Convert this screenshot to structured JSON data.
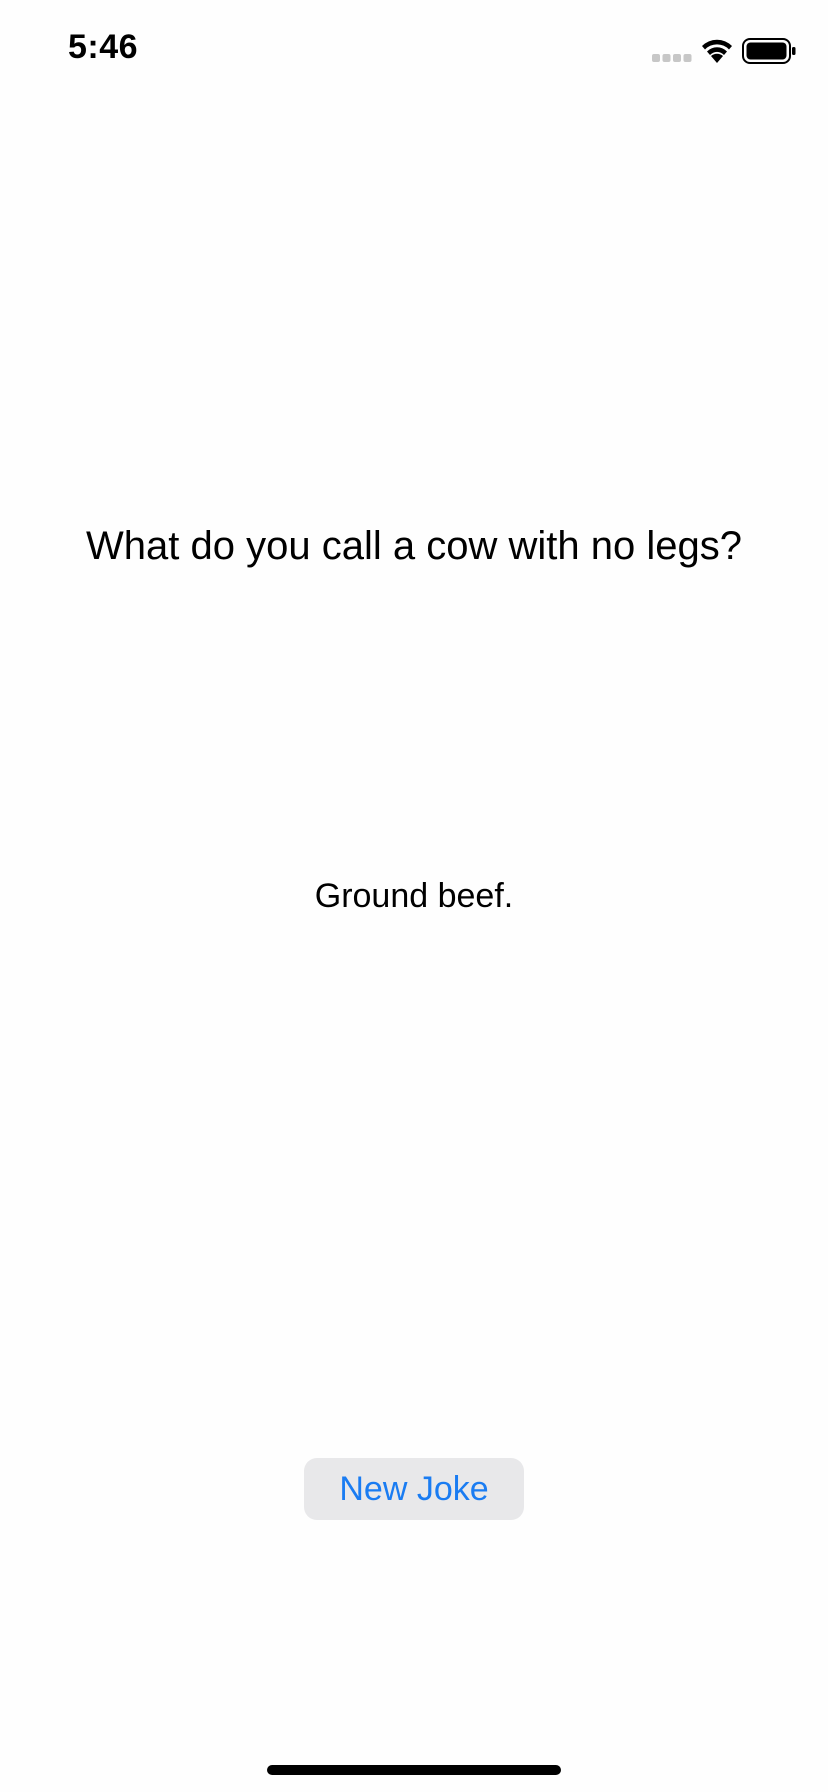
{
  "status_bar": {
    "time": "5:46",
    "icons": [
      "cellular-signal-icon",
      "wifi-icon",
      "battery-icon"
    ]
  },
  "joke": {
    "setup": "What do you call a cow with no legs?",
    "punchline": "Ground beef."
  },
  "actions": {
    "new_joke_label": "New Joke"
  },
  "colors": {
    "background": "#fefefe",
    "text": "#000000",
    "button_background": "#e8e8ea",
    "button_text": "#1a7cf2"
  }
}
